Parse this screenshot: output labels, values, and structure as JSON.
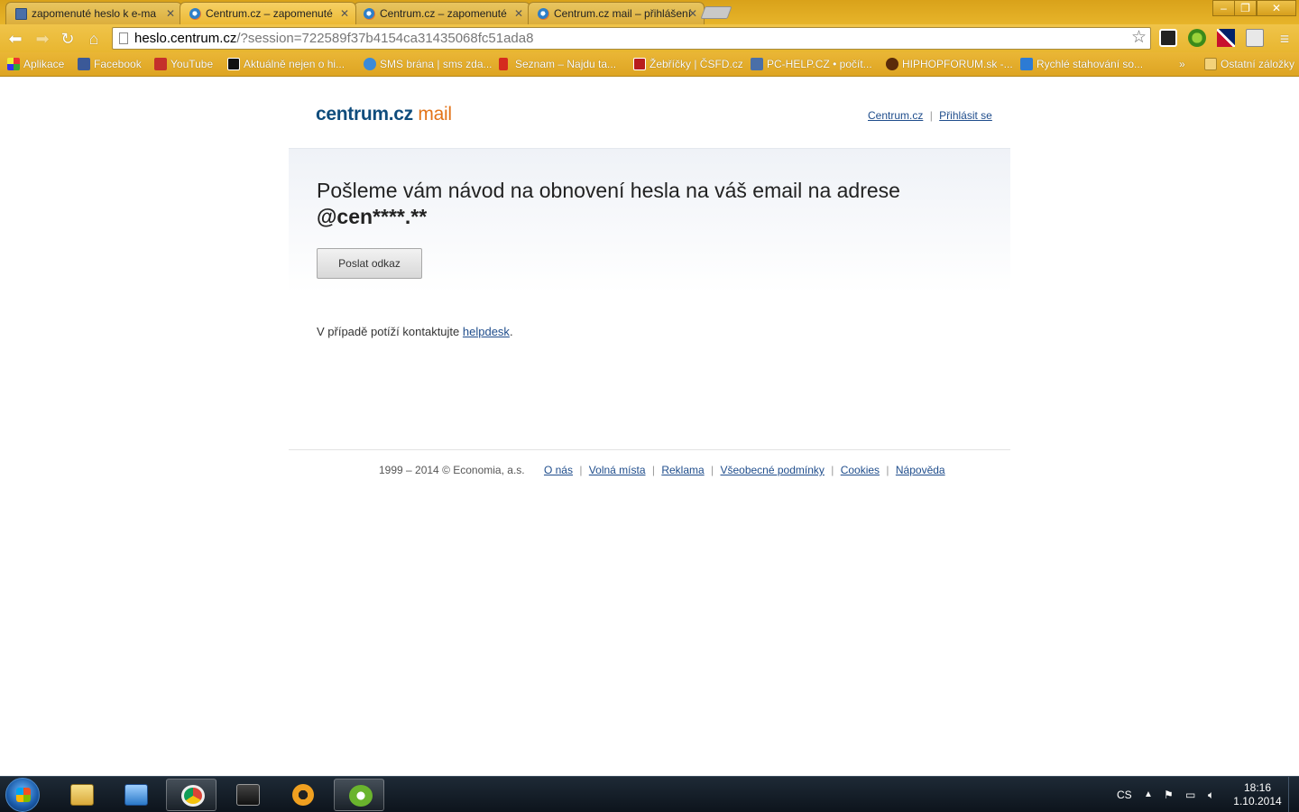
{
  "browser": {
    "tabs": [
      {
        "title": "zapomenuté heslo k e-ma",
        "favicon": "computer-icon",
        "active": false
      },
      {
        "title": "Centrum.cz – zapomenuté",
        "favicon": "centrum-icon",
        "active": true
      },
      {
        "title": "Centrum.cz – zapomenuté",
        "favicon": "centrum-icon",
        "active": false
      },
      {
        "title": "Centrum.cz mail – přihlášení",
        "favicon": "centrum-icon",
        "active": false
      }
    ],
    "url_host": "heslo.centrum.cz",
    "url_rest": "/?session=722589f37b4154ca31435068fc51ada8",
    "bookmarks": [
      {
        "label": "Aplikace",
        "icon": "apps-icon"
      },
      {
        "label": "Facebook",
        "icon": "facebook-icon"
      },
      {
        "label": "YouTube",
        "icon": "youtube-icon"
      },
      {
        "label": "Aktuálně nejen o hi...",
        "icon": "b-icon"
      },
      {
        "label": "SMS brána | sms zda...",
        "icon": "sms-icon"
      },
      {
        "label": "Seznam – Najdu ta...",
        "icon": "seznam-icon"
      },
      {
        "label": "Žebříčky | ČSFD.cz",
        "icon": "csfd-icon"
      },
      {
        "label": "PC-HELP.CZ • počít...",
        "icon": "pc-help-icon"
      },
      {
        "label": "HIPHOPFORUM.sk -...",
        "icon": "hiphop-icon"
      },
      {
        "label": "Rychlé stahování so...",
        "icon": "d-icon"
      }
    ],
    "more_bookmarks": "»",
    "other_bookmarks": "Ostatní záložky",
    "colors": {
      "chrome_theme": "#e8b630",
      "link": "#1f4d8c",
      "logo_blue": "#0f4c7c",
      "logo_orange": "#e37318"
    }
  },
  "page": {
    "logo_part1": "centrum.cz",
    "logo_part2": "mail",
    "toplinks": {
      "centrum": "Centrum.cz",
      "sep": "|",
      "login": "Přihlásit se"
    },
    "heading_text": "Pošleme vám návod na obnovení hesla na váš email na adrese",
    "masked_email": "@cen****.**",
    "send_button": "Poslat odkaz",
    "help_prefix": "V případě potíží kontaktujte ",
    "help_link": "helpdesk",
    "help_suffix": ".",
    "footer": {
      "copyright": "1999 – 2014 © Economia, a.s.",
      "links": [
        "O nás",
        "Volná místa",
        "Reklama",
        "Všeobecné podmínky",
        "Cookies",
        "Nápověda"
      ],
      "sep": "|"
    }
  },
  "taskbar": {
    "language": "CS",
    "time": "18:16",
    "date": "1.10.2014"
  }
}
